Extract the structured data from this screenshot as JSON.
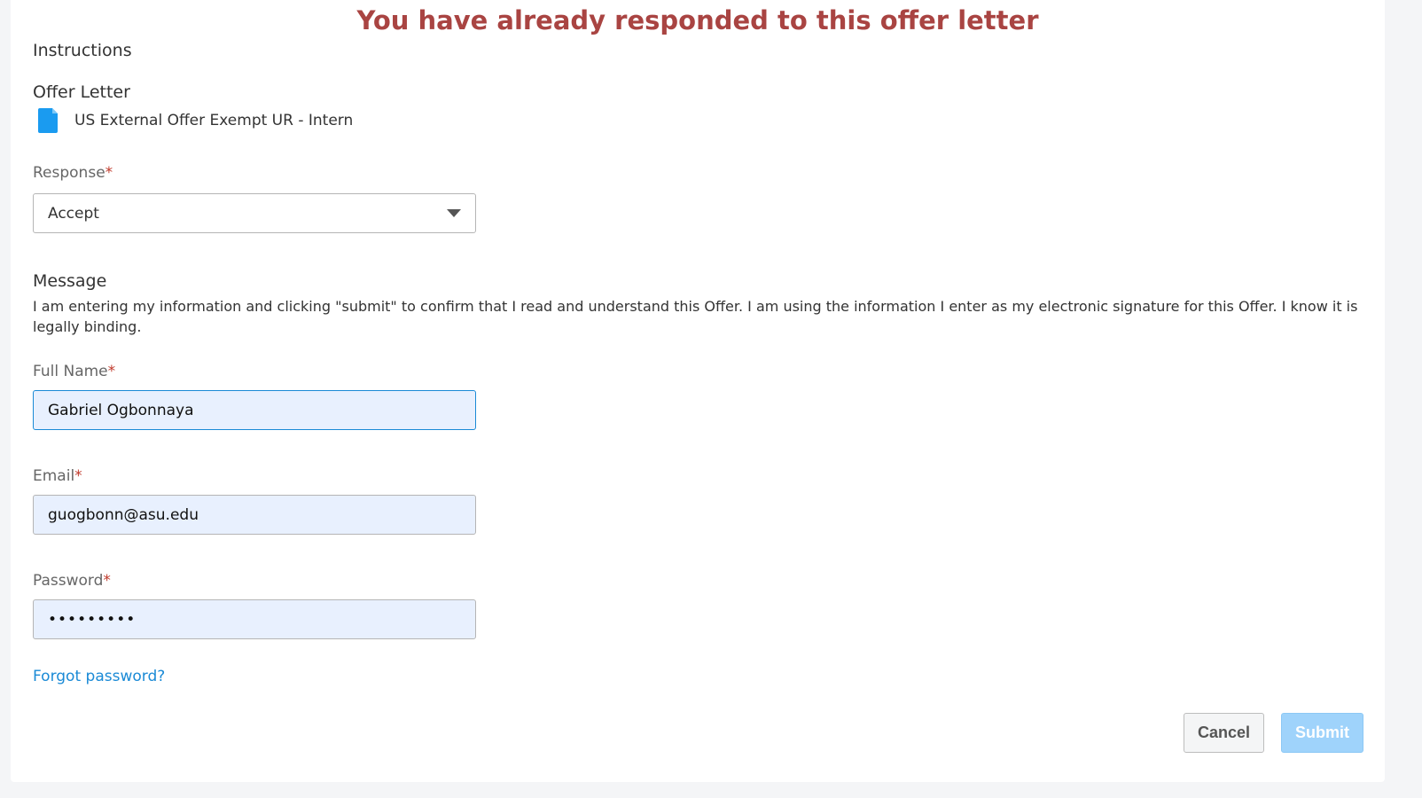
{
  "banner": {
    "text": "You have already responded to this offer letter"
  },
  "sections": {
    "instructions": "Instructions",
    "offer_letter": "Offer Letter",
    "message": "Message"
  },
  "offer_letter": {
    "document_name": "US External Offer Exempt UR - Intern",
    "icon": "document-icon"
  },
  "response": {
    "label": "Response",
    "required_mark": "*",
    "selected": "Accept"
  },
  "message_text": "I am entering my information and clicking \"submit\" to confirm that I read and understand this Offer. I am using the information I enter as my electronic signature for this Offer. I know it is legally binding.",
  "full_name": {
    "label": "Full Name",
    "required_mark": "*",
    "value": "Gabriel Ogbonnaya"
  },
  "email": {
    "label": "Email",
    "required_mark": "*",
    "value": "guogbonn@asu.edu"
  },
  "password": {
    "label": "Password",
    "required_mark": "*",
    "value": "•••••••••"
  },
  "forgot_password": "Forgot password?",
  "buttons": {
    "cancel": "Cancel",
    "submit": "Submit"
  },
  "colors": {
    "banner": "#a94442",
    "link": "#1a8ad6",
    "required": "#c0392b",
    "submit_disabled": "#9fd3fb",
    "autofill_bg": "#e8f0fe"
  }
}
